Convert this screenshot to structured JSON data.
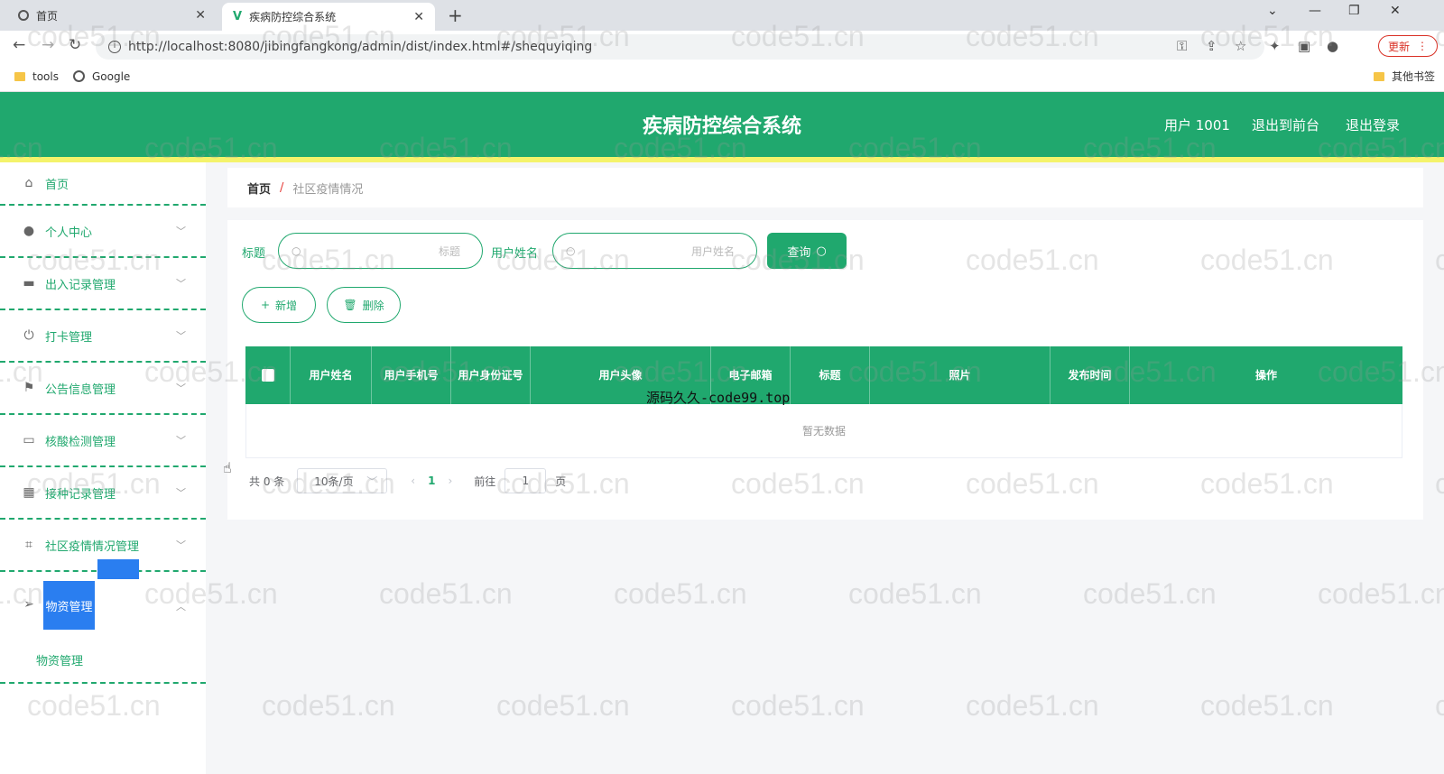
{
  "browser": {
    "tabs": [
      {
        "title": "首页",
        "active": false
      },
      {
        "title": "疾病防控综合系统",
        "active": true
      }
    ],
    "new_tab": "+",
    "url": "http://localhost:8080/jibingfangkong/admin/dist/index.html#/shequyiqing",
    "update_label": "更新",
    "bookmarks": [
      {
        "label": "tools",
        "icon": "folder-icon"
      },
      {
        "label": "Google",
        "icon": "globe-icon"
      }
    ],
    "other_bookmarks": "其他书签"
  },
  "header": {
    "title": "疾病防控综合系统",
    "user_label": "用户 1001",
    "to_front_label": "退出到前台",
    "logout_label": "退出登录",
    "colors": {
      "primary": "#20a86e",
      "stripe": "#f4f36b"
    }
  },
  "sidebar": {
    "items": [
      {
        "label": "首页",
        "icon": "home-icon",
        "has_children": false
      },
      {
        "label": "个人中心",
        "icon": "user-icon",
        "has_children": true
      },
      {
        "label": "出入记录管理",
        "icon": "document-icon",
        "has_children": true
      },
      {
        "label": "打卡管理",
        "icon": "power-icon",
        "has_children": true
      },
      {
        "label": "公告信息管理",
        "icon": "flag-icon",
        "has_children": true
      },
      {
        "label": "核酸检测管理",
        "icon": "chat-icon",
        "has_children": true
      },
      {
        "label": "接种记录管理",
        "icon": "grid-icon",
        "has_children": true
      },
      {
        "label": "社区疫情情况管理",
        "icon": "crop-icon",
        "has_children": true
      },
      {
        "label": "物资管理",
        "icon": "send-icon",
        "has_children": true
      }
    ],
    "sub_item": "物资管理"
  },
  "breadcrumb": {
    "home": "首页",
    "separator": "/",
    "current": "社区疫情情况"
  },
  "search": {
    "title_label": "标题",
    "title_placeholder": "标题",
    "username_label": "用户姓名",
    "username_placeholder": "用户姓名",
    "query_label": "查询"
  },
  "actions": {
    "add_label": "新增",
    "delete_label": "删除"
  },
  "table": {
    "columns": [
      "用户姓名",
      "用户手机号",
      "用户身份证号",
      "用户头像",
      "电子邮箱",
      "标题",
      "照片",
      "发布时间",
      "操作"
    ],
    "empty_text": "暂无数据"
  },
  "pagination": {
    "total_text": "共 0 条",
    "page_size": "10条/页",
    "current_page": "1",
    "goto_label": "前往",
    "goto_value": "1",
    "page_suffix": "页"
  },
  "overlay_text": "源码久久-code99.top",
  "watermark": "code51.cn"
}
